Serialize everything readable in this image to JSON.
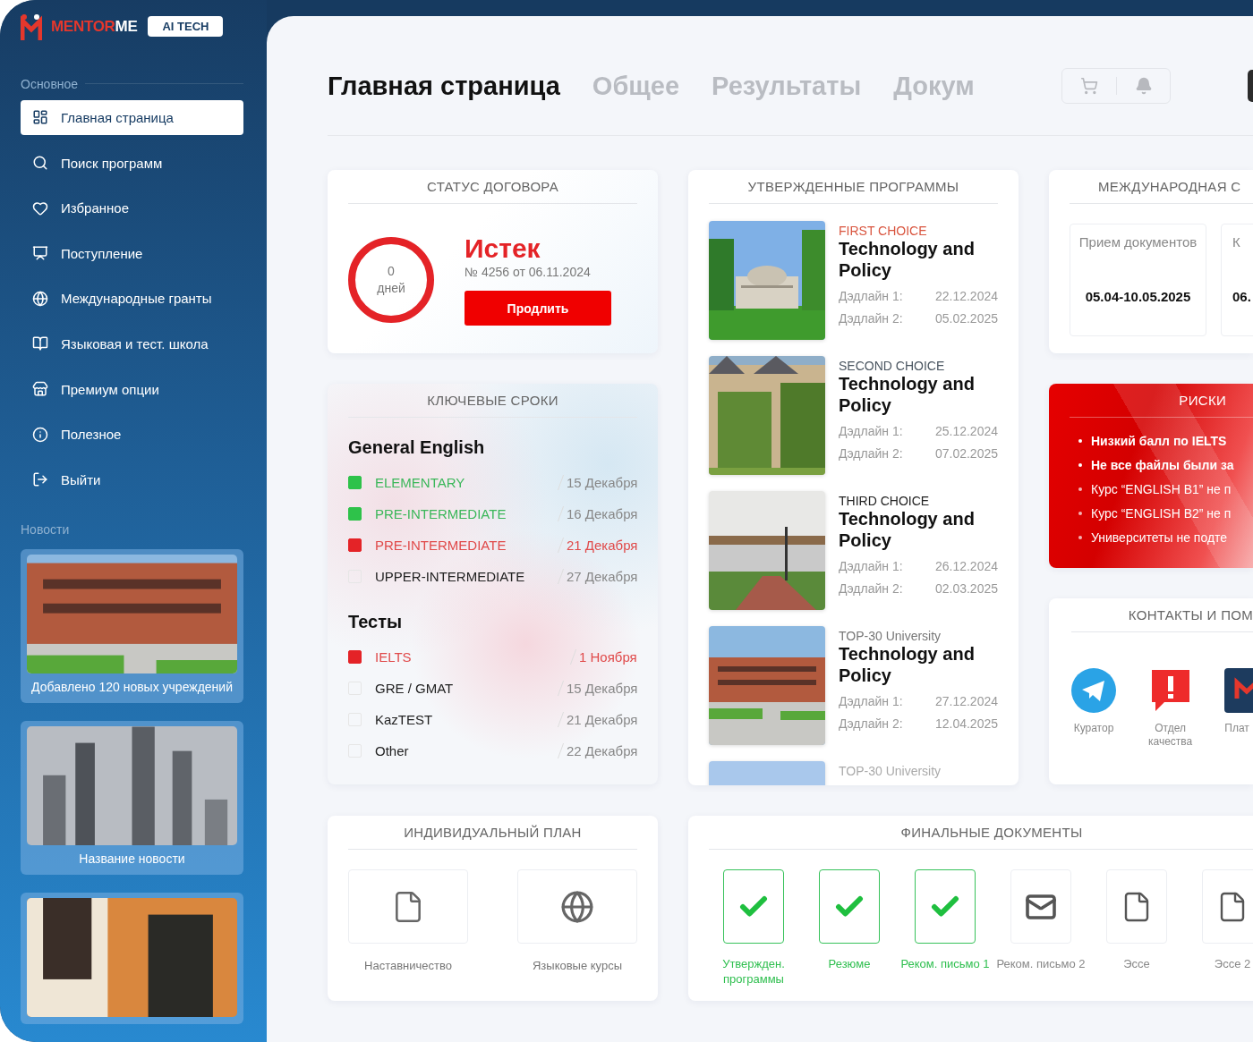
{
  "sidebar": {
    "logo": {
      "first": "MENTOR",
      "second": "ME"
    },
    "badge": "AI TECH",
    "section": "Основное",
    "items": [
      {
        "label": "Главная страница",
        "selected": true
      },
      {
        "label": "Поиск программ",
        "selected": false
      },
      {
        "label": "Избранное",
        "selected": false
      },
      {
        "label": "Поступление",
        "selected": false
      },
      {
        "label": "Международные гранты",
        "selected": false
      },
      {
        "label": "Языковая и тест. школа",
        "selected": false
      },
      {
        "label": "Премиум опции",
        "selected": false
      },
      {
        "label": "Полезное",
        "selected": false
      },
      {
        "label": "Выйти",
        "selected": false
      }
    ],
    "news_title": "Новости",
    "news": [
      {
        "caption": "Добавлено 120 новых учреждений"
      },
      {
        "caption": "Название новости"
      },
      {
        "kind": "picture"
      }
    ]
  },
  "header": {
    "tabs": [
      {
        "label": "Главная страница",
        "selected": true
      },
      {
        "label": "Общее",
        "selected": false
      },
      {
        "label": "Результаты",
        "selected": false
      },
      {
        "label": "Докум",
        "selected": false
      }
    ]
  },
  "contract": {
    "title": "СТАТУС ДОГОВОРА",
    "days": "0",
    "days_unit": "дней",
    "status": "Истек",
    "number": "№ 4256 от 06.11.2024",
    "button": "Продлить"
  },
  "deadlines": {
    "title": "КЛЮЧЕВЫЕ СРОКИ",
    "groups": [
      {
        "name": "General English",
        "rows": [
          {
            "label": "ELEMENTARY",
            "date": "15 Декабря",
            "kind": "done"
          },
          {
            "label": "PRE-INTERMEDIATE",
            "date": "16 Декабря",
            "kind": "done"
          },
          {
            "label": "PRE-INTERMEDIATE",
            "date": "21 Декабря",
            "kind": "overdue"
          },
          {
            "label": "UPPER-INTERMEDIATE",
            "date": "27 Декабря",
            "kind": "pending"
          }
        ]
      },
      {
        "name": "Тесты",
        "rows": [
          {
            "label": "IELTS",
            "date": "1 Ноября",
            "kind": "overdue"
          },
          {
            "label": "GRE / GMAT",
            "date": "15 Декабря",
            "kind": "pending"
          },
          {
            "label": "KazTEST",
            "date": "21 Декабря",
            "kind": "pending"
          },
          {
            "label": "Other",
            "date": "22 Декабря",
            "kind": "pending"
          }
        ]
      }
    ]
  },
  "programs": {
    "title": "УТВЕРЖДЕННЫЕ ПРОГРАММЫ",
    "items": [
      {
        "choice": "FIRST CHOICE",
        "color": "#d9553f",
        "name": "Technology and Policy",
        "deadline1_label": "Дэдлайн 1:",
        "deadline1": "22.12.2024",
        "deadline2_label": "Дэдлайн 2:",
        "deadline2": "05.02.2025"
      },
      {
        "choice": "SECOND CHOICE",
        "color": "#4a5560",
        "name": "Technology and Policy",
        "deadline1_label": "Дэдлайн 1:",
        "deadline1": "25.12.2024",
        "deadline2_label": "Дэдлайн 2:",
        "deadline2": "07.02.2025"
      },
      {
        "choice": "THIRD CHOICE",
        "color": "#222222",
        "name": "Technology and Policy",
        "deadline1_label": "Дэдлайн 1:",
        "deadline1": "26.12.2024",
        "deadline2_label": "Дэдлайн 2:",
        "deadline2": "02.03.2025"
      },
      {
        "choice": "TOP-30 University",
        "color": "#777777",
        "name": "Technology and Policy",
        "deadline1_label": "Дэдлайн 1:",
        "deadline1": "27.12.2024",
        "deadline2_label": "Дэдлайн 2:",
        "deadline2": "12.04.2025"
      },
      {
        "choice": "TOP-30 University",
        "color": "#aaaaaa"
      }
    ]
  },
  "international": {
    "title": "МЕЖДУНАРОДНАЯ С",
    "boxes": [
      {
        "label": "Прием документов",
        "date": "05.04-10.05.2025"
      },
      {
        "label": "К",
        "date": "06."
      }
    ]
  },
  "risks": {
    "title": "РИСКИ",
    "items": [
      {
        "text": "Низкий балл по IELTS",
        "kind": "critical"
      },
      {
        "text": "Не все файлы были за",
        "kind": "critical"
      },
      {
        "text": "Курс “ENGLISH B1” не п",
        "kind": "note"
      },
      {
        "text": "Курс “ENGLISH B2” не п",
        "kind": "note"
      },
      {
        "text": "Университеты не подте",
        "kind": "note"
      }
    ]
  },
  "contacts": {
    "title": "КОНТАКТЫ И ПОМ",
    "items": [
      {
        "label": "Куратор"
      },
      {
        "label": "Отдел качества"
      },
      {
        "label": "Плат"
      }
    ]
  },
  "plan": {
    "title": "ИНДИВИДУАЛЬНЫЙ ПЛАН",
    "items": [
      {
        "label": "Наставничество"
      },
      {
        "label": "Языковые курсы"
      }
    ]
  },
  "documents": {
    "title": "ФИНАЛЬНЫЕ ДОКУМЕНТЫ",
    "items": [
      {
        "label": "Утвержден. программы",
        "done": true
      },
      {
        "label": "Резюме",
        "done": true
      },
      {
        "label": "Реком. письмо 1",
        "done": true
      },
      {
        "label": "Реком. письмо 2",
        "done": false,
        "kind": "letter"
      },
      {
        "label": "Эссе",
        "done": false,
        "kind": "file"
      },
      {
        "label": "Эссе 2",
        "done": false,
        "kind": "file"
      }
    ]
  }
}
